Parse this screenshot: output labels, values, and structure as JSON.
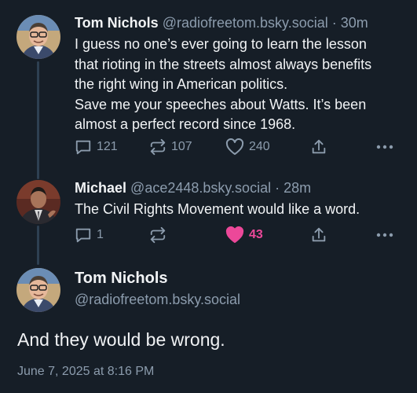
{
  "posts": [
    {
      "author": "Tom Nichols",
      "handle": "@radiofreetom.bsky.social",
      "time": "30m",
      "lines": [
        "I guess no one’s ever going to learn the lesson",
        "that rioting in the streets almost always benefits",
        "the right wing in American politics.",
        "Save me your speeches about Watts. It’s been",
        "almost a perfect record since 1968."
      ],
      "reply_count": "121",
      "repost_count": "107",
      "like_count": "240",
      "liked": false
    },
    {
      "author": "Michael",
      "handle": "@ace2448.bsky.social",
      "time": "28m",
      "lines": [
        "The Civil Rights Movement would like a word."
      ],
      "reply_count": "1",
      "repost_count": "",
      "like_count": "43",
      "liked": true
    }
  ],
  "main_post": {
    "author": "Tom Nichols",
    "handle": "@radiofreetom.bsky.social",
    "text": "And they would be wrong.",
    "timestamp": "June 7, 2025 at 8:16 PM"
  },
  "separator": " · ",
  "icons": {
    "reply": "reply-icon",
    "repost": "repost-icon",
    "like": "heart-icon",
    "share": "share-icon",
    "more": "more-dots-icon"
  },
  "colors": {
    "background": "#161e27",
    "text": "#f1f3f5",
    "muted": "#8c9cad",
    "like": "#ec4899",
    "thread_line": "#2e4052"
  }
}
